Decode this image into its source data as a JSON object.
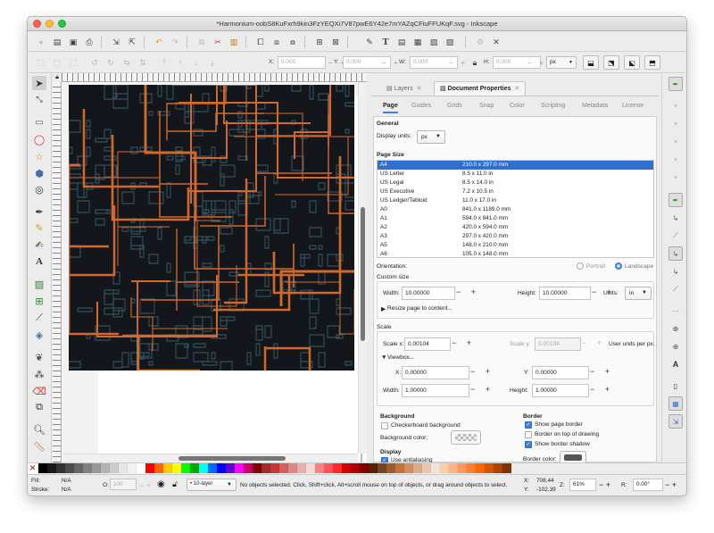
{
  "window": {
    "title": "*Harmonium-oobS8KuFxrh9kin3FzYEQXi7V87pwE6Y42e7mYAZqCFiuFFUKqF.svg - Inkscape"
  },
  "toolbar_icons": [
    "new-document-icon",
    "open-icon",
    "save-icon",
    "print-icon",
    "import-icon",
    "export-icon",
    "undo-icon",
    "redo-icon",
    "copy-icon",
    "cut-icon",
    "paste-icon",
    "zoom-selection-icon",
    "zoom-drawing-icon",
    "zoom-page-icon",
    "duplicate-icon",
    "clone-icon",
    "unlink-clone-icon",
    "group-icon",
    "ungroup-icon",
    "fill-stroke-icon",
    "text-tool-icon",
    "layers-icon",
    "xml-editor-icon",
    "align-icon",
    "document-properties-icon",
    "preferences-icon"
  ],
  "coords": {
    "x_label": "X:",
    "x_value": "0.000",
    "y_label": "Y:",
    "y_value": "0.000",
    "w_label": "W:",
    "w_value": "0.000",
    "h_label": "H:",
    "h_value": "0.000",
    "unit": "px"
  },
  "dialog": {
    "tabs": [
      {
        "label": "Layers"
      },
      {
        "label": "Document Properties"
      }
    ],
    "subtabs": [
      "Page",
      "Guides",
      "Grids",
      "Snap",
      "Color",
      "Scripting",
      "Metadata",
      "License"
    ],
    "general_heading": "General",
    "display_units_label": "Display units:",
    "display_units_value": "px",
    "page_size_heading": "Page Size",
    "page_sizes": [
      {
        "name": "A4",
        "size": "210.0 x 297.0 mm"
      },
      {
        "name": "US Letter",
        "size": "8.5 x 11.0 in"
      },
      {
        "name": "US Legal",
        "size": "8.5 x 14.0 in"
      },
      {
        "name": "US Executive",
        "size": "7.2 x 10.5 in"
      },
      {
        "name": "US Ledger/Tabloid",
        "size": "11.0 x 17.0 in"
      },
      {
        "name": "A0",
        "size": "841.0 x 1189.0 mm"
      },
      {
        "name": "A1",
        "size": "594.0 x 841.0 mm"
      },
      {
        "name": "A2",
        "size": "420.0 x 594.0 mm"
      },
      {
        "name": "A3",
        "size": "297.0 x 420.0 mm"
      },
      {
        "name": "A5",
        "size": "148.0 x 210.0 mm"
      },
      {
        "name": "A6",
        "size": "105.0 x 148.0 mm"
      }
    ],
    "orientation_label": "Orientation:",
    "portrait_label": "Portrait",
    "landscape_label": "Landscape",
    "custom_size_heading": "Custom size",
    "width_label": "Width:",
    "width_value": "10.00000",
    "height_label": "Height:",
    "height_value": "10.00000",
    "units_label": "Units:",
    "units_value": "in",
    "resize_label": "Resize page to content...",
    "scale_heading": "Scale",
    "scale_x_label": "Scale x:",
    "scale_x_value": "0.00104",
    "scale_y_label": "Scale y:",
    "scale_y_value": "0.00104",
    "user_units_label": "User units per px.",
    "viewbox_label": "Viewbox...",
    "vb_x_label": "X:",
    "vb_x_value": "0.00000",
    "vb_y_label": "Y:",
    "vb_y_value": "0.00000",
    "vb_w_label": "Width:",
    "vb_w_value": "1.00000",
    "vb_h_label": "Height:",
    "vb_h_value": "1.00000",
    "background_heading": "Background",
    "checkerboard_label": "Checkerboard background",
    "bg_color_label": "Background color:",
    "display_heading": "Display",
    "antialias_label": "Use antialiasing",
    "border_heading": "Border",
    "show_border_label": "Show page border",
    "border_on_top_label": "Border on top of drawing",
    "border_shadow_label": "Show border shadow",
    "border_color_label": "Border color:",
    "border_color": "#555555"
  },
  "status": {
    "fill_label": "Fill:",
    "fill_value": "N/A",
    "stroke_label": "Stroke:",
    "stroke_value": "N/A",
    "opacity_label": "O:",
    "opacity_value": "100",
    "layer_value": "• 10-layer",
    "message": "No objects selected. Click, Shift+click, Alt+scroll mouse on top of objects, or drag around objects to select.",
    "x_label": "X:",
    "x_value": "708.44",
    "y_label": "Y:",
    "y_value": "-102.39",
    "zoom_label": "Z:",
    "zoom_value": "61%",
    "rotate_label": "R:",
    "rotate_value": "0.00°"
  },
  "palette_colors": [
    "#000000",
    "#1a1a1a",
    "#333333",
    "#4d4d4d",
    "#666666",
    "#808080",
    "#999999",
    "#b3b3b3",
    "#cccccc",
    "#e6e6e6",
    "#f2f2f2",
    "#ffffff",
    "#ff0000",
    "#ff6600",
    "#ffcc00",
    "#ffff00",
    "#00ff00",
    "#00aa00",
    "#00ffff",
    "#0066ff",
    "#0000ff",
    "#6600cc",
    "#ff00ff",
    "#cc0066",
    "#800000",
    "#a02c2c",
    "#c83737",
    "#d35f5f",
    "#de8787",
    "#e9afaf",
    "#f4d7d7",
    "#ff8080",
    "#ff5555",
    "#ff2a2a",
    "#d40000",
    "#aa0000",
    "#800000",
    "#552200",
    "#784421",
    "#a05a2c",
    "#c87137",
    "#d38d5f",
    "#deaa87",
    "#e9c6af",
    "#f4e3d7",
    "#ffccaa",
    "#ffb380",
    "#ff9955",
    "#ff7f2a",
    "#ff6600",
    "#d45500",
    "#aa4400",
    "#803300"
  ],
  "colors": {
    "selection": "#2f6fd0",
    "accent": "#3b82d6",
    "artwork_bg": "#13171b",
    "circuit_orange": "#d2692b",
    "circuit_blue": "#3e6478"
  }
}
